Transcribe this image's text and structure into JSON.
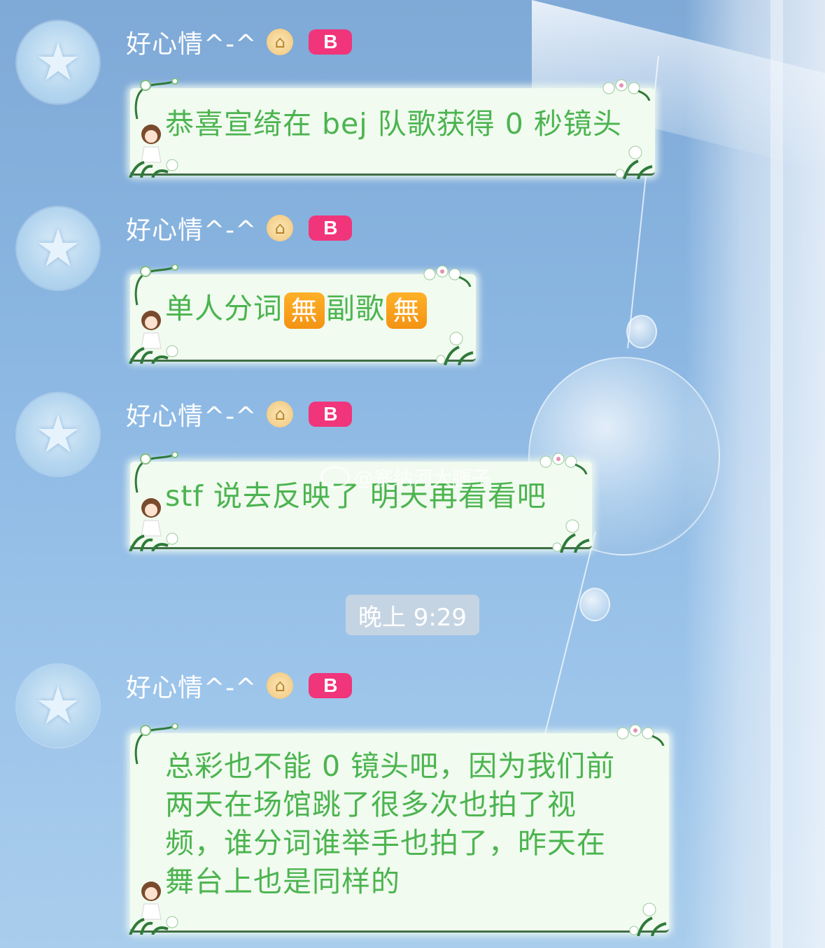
{
  "user": {
    "nickname": "好心情^-^",
    "badge": "B",
    "house_icon": "house-icon",
    "avatar_icon": "star-kitty-avatar"
  },
  "messages": [
    {
      "text": "恭喜宣绮在 bej 队歌获得 0 秒镜头"
    },
    {
      "parts": [
        "单人分词",
        "無",
        "副歌",
        "無"
      ]
    },
    {
      "text": "stf 说去反映了 明天再看看吧"
    },
    {
      "lines": [
        "总彩也不能 0 镜头吧，因为我们前",
        "两天在场馆跳了很多次也拍了视",
        "频，谁分词谁举手也拍了，昨天在",
        "舞台上也是同样的"
      ]
    }
  ],
  "timestamp": "晚上 9:29",
  "watermark": "@寨纳河大腿子",
  "colors": {
    "bubble_bg": "#f1fbf0",
    "bubble_text": "#4cb44f",
    "badge": "#f0357a",
    "emoji_box": "#f39313"
  }
}
